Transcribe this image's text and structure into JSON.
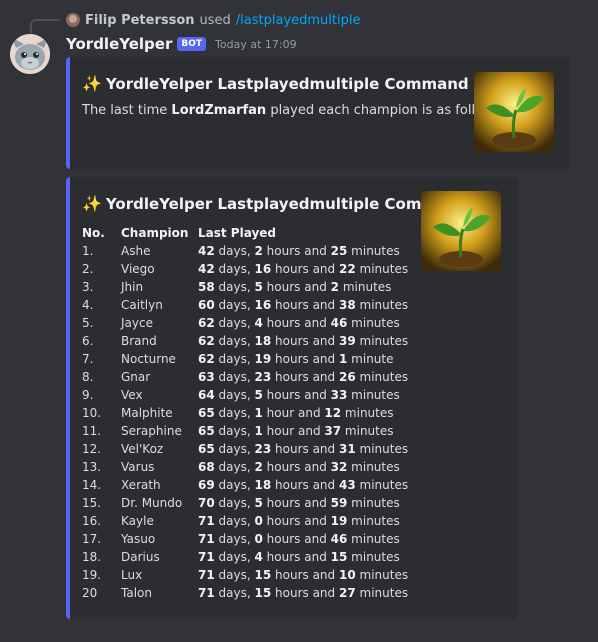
{
  "reply": {
    "user": "Filip Petersson",
    "used": "used",
    "command": "/lastplayedmultiple"
  },
  "message": {
    "username": "YordleYelper",
    "badge": "BOT",
    "timestamp": "Today at 17:09"
  },
  "embed1": {
    "title_icon": "✨",
    "title": "YordleYelper Lastplayedmultiple Command",
    "desc_prefix": "The last time ",
    "player": "LordZmarfan",
    "desc_suffix": " played each champion is as follows:"
  },
  "embed2": {
    "title_icon": "✨",
    "title": "YordleYelper Lastplayedmultiple Command",
    "headers": {
      "no": "No.",
      "champion": "Champion",
      "last_played": "Last Played"
    },
    "rows": [
      {
        "no": "1.",
        "champion": "Ashe",
        "d": "42",
        "h": "2",
        "hunit": "hours",
        "m": "25",
        "munit": "minutes"
      },
      {
        "no": "2.",
        "champion": "Viego",
        "d": "42",
        "h": "16",
        "hunit": "hours",
        "m": "22",
        "munit": "minutes"
      },
      {
        "no": "3.",
        "champion": "Jhin",
        "d": "58",
        "h": "5",
        "hunit": "hours",
        "m": "2",
        "munit": "minutes"
      },
      {
        "no": "4.",
        "champion": "Caitlyn",
        "d": "60",
        "h": "16",
        "hunit": "hours",
        "m": "38",
        "munit": "minutes"
      },
      {
        "no": "5.",
        "champion": "Jayce",
        "d": "62",
        "h": "4",
        "hunit": "hours",
        "m": "46",
        "munit": "minutes"
      },
      {
        "no": "6.",
        "champion": "Brand",
        "d": "62",
        "h": "18",
        "hunit": "hours",
        "m": "39",
        "munit": "minutes"
      },
      {
        "no": "7.",
        "champion": "Nocturne",
        "d": "62",
        "h": "19",
        "hunit": "hours",
        "m": "1",
        "munit": "minute"
      },
      {
        "no": "8.",
        "champion": "Gnar",
        "d": "63",
        "h": "23",
        "hunit": "hours",
        "m": "26",
        "munit": "minutes"
      },
      {
        "no": "9.",
        "champion": "Vex",
        "d": "64",
        "h": "5",
        "hunit": "hours",
        "m": "33",
        "munit": "minutes"
      },
      {
        "no": "10.",
        "champion": "Malphite",
        "d": "65",
        "h": "1",
        "hunit": "hour",
        "m": "12",
        "munit": "minutes"
      },
      {
        "no": "11.",
        "champion": "Seraphine",
        "d": "65",
        "h": "1",
        "hunit": "hour",
        "m": "37",
        "munit": "minutes"
      },
      {
        "no": "12.",
        "champion": "Vel'Koz",
        "d": "65",
        "h": "23",
        "hunit": "hours",
        "m": "31",
        "munit": "minutes"
      },
      {
        "no": "13.",
        "champion": "Varus",
        "d": "68",
        "h": "2",
        "hunit": "hours",
        "m": "32",
        "munit": "minutes"
      },
      {
        "no": "14.",
        "champion": "Xerath",
        "d": "69",
        "h": "18",
        "hunit": "hours",
        "m": "43",
        "munit": "minutes"
      },
      {
        "no": "15.",
        "champion": "Dr. Mundo",
        "d": "70",
        "h": "5",
        "hunit": "hours",
        "m": "59",
        "munit": "minutes"
      },
      {
        "no": "16.",
        "champion": "Kayle",
        "d": "71",
        "h": "0",
        "hunit": "hours",
        "m": "19",
        "munit": "minutes"
      },
      {
        "no": "17.",
        "champion": "Yasuo",
        "d": "71",
        "h": "0",
        "hunit": "hours",
        "m": "46",
        "munit": "minutes"
      },
      {
        "no": "18.",
        "champion": "Darius",
        "d": "71",
        "h": "4",
        "hunit": "hours",
        "m": "15",
        "munit": "minutes"
      },
      {
        "no": "19.",
        "champion": "Lux",
        "d": "71",
        "h": "15",
        "hunit": "hours",
        "m": "10",
        "munit": "minutes"
      },
      {
        "no": "20",
        "champion": "Talon",
        "d": "71",
        "h": "15",
        "hunit": "hours",
        "m": "27",
        "munit": "minutes"
      }
    ]
  },
  "colors": {
    "background": "#313338",
    "embed_bg": "#2b2d31",
    "accent": "#5865f2",
    "link": "#00a8fc"
  },
  "icons": {
    "avatar": "yordle-avatar-icon",
    "thumbnail": "sprout-icon",
    "reply_avatar": "user-avatar-icon"
  }
}
